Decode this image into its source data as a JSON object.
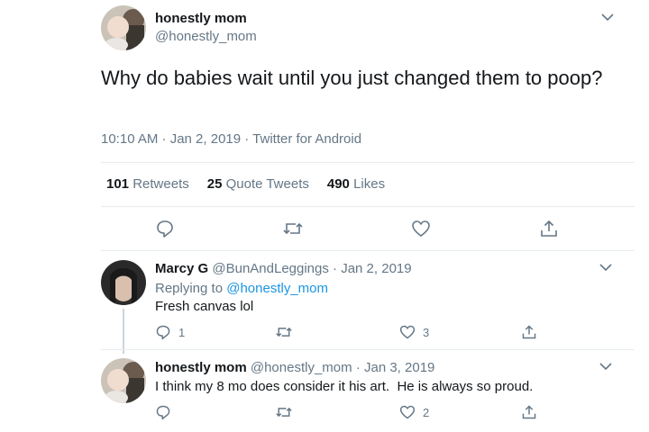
{
  "main_tweet": {
    "display_name": "honestly mom",
    "handle": "@honestly_mom",
    "text": "Why do babies wait until you just changed them to poop?",
    "timestamp": "10:10 AM · Jan 2, 2019 · Twitter for Android",
    "stats": {
      "retweets_count": "101",
      "retweets_label": "Retweets",
      "quotes_count": "25",
      "quotes_label": "Quote Tweets",
      "likes_count": "490",
      "likes_label": "Likes"
    },
    "icons": [
      "reply-icon",
      "retweet-icon",
      "like-icon",
      "share-icon"
    ]
  },
  "replies": [
    {
      "display_name": "Marcy G",
      "handle": "@BunAndLeggings",
      "date": "· Jan 2, 2019",
      "replying_to_label": "Replying to",
      "replying_to_handle": "@honestly_mom",
      "text": "Fresh canvas lol",
      "reply_count": "1",
      "retweet_count": "",
      "like_count": "3"
    },
    {
      "display_name": "honestly mom",
      "handle": "@honestly_mom",
      "date": "· Jan 3, 2019",
      "text": "I think my 8 mo does consider it his art.  He is always so proud.",
      "reply_count": "",
      "retweet_count": "",
      "like_count": "2"
    }
  ],
  "colors": {
    "text": "#14171a",
    "muted": "#657786",
    "link": "#1b95e0",
    "border": "#e6ecf0",
    "thread_line": "#ccd6dd"
  }
}
